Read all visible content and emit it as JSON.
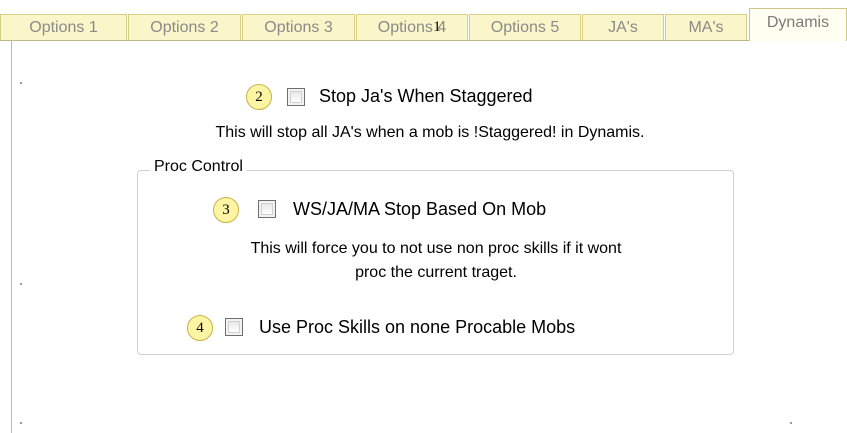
{
  "tabs": [
    {
      "label": "Options 1"
    },
    {
      "label": "Options 2"
    },
    {
      "label": "Options 3"
    },
    {
      "label": "Options 4"
    },
    {
      "label": "Options 5"
    },
    {
      "label": "JA's"
    },
    {
      "label": "MA's"
    },
    {
      "label": "Dynamis",
      "active": true
    }
  ],
  "markers": {
    "m1": "1",
    "m2": "2",
    "m3": "3",
    "m4": "4"
  },
  "stop_ja": {
    "label": "Stop Ja's When Staggered",
    "checked": false,
    "description": "This will stop all JA's when a mob is !Staggered! in Dynamis."
  },
  "proc_control": {
    "title": "Proc Control",
    "ws_stop": {
      "label": "WS/JA/MA Stop Based On Mob",
      "checked": false,
      "description_line1": "This will force you to not use non proc skills if it wont",
      "description_line2": "proc the current traget."
    },
    "use_proc": {
      "label": "Use Proc Skills on none Procable Mobs",
      "checked": false
    }
  },
  "colors": {
    "tab_bg": "#fbf6c9",
    "marker_bg": "#fdf5a4"
  }
}
